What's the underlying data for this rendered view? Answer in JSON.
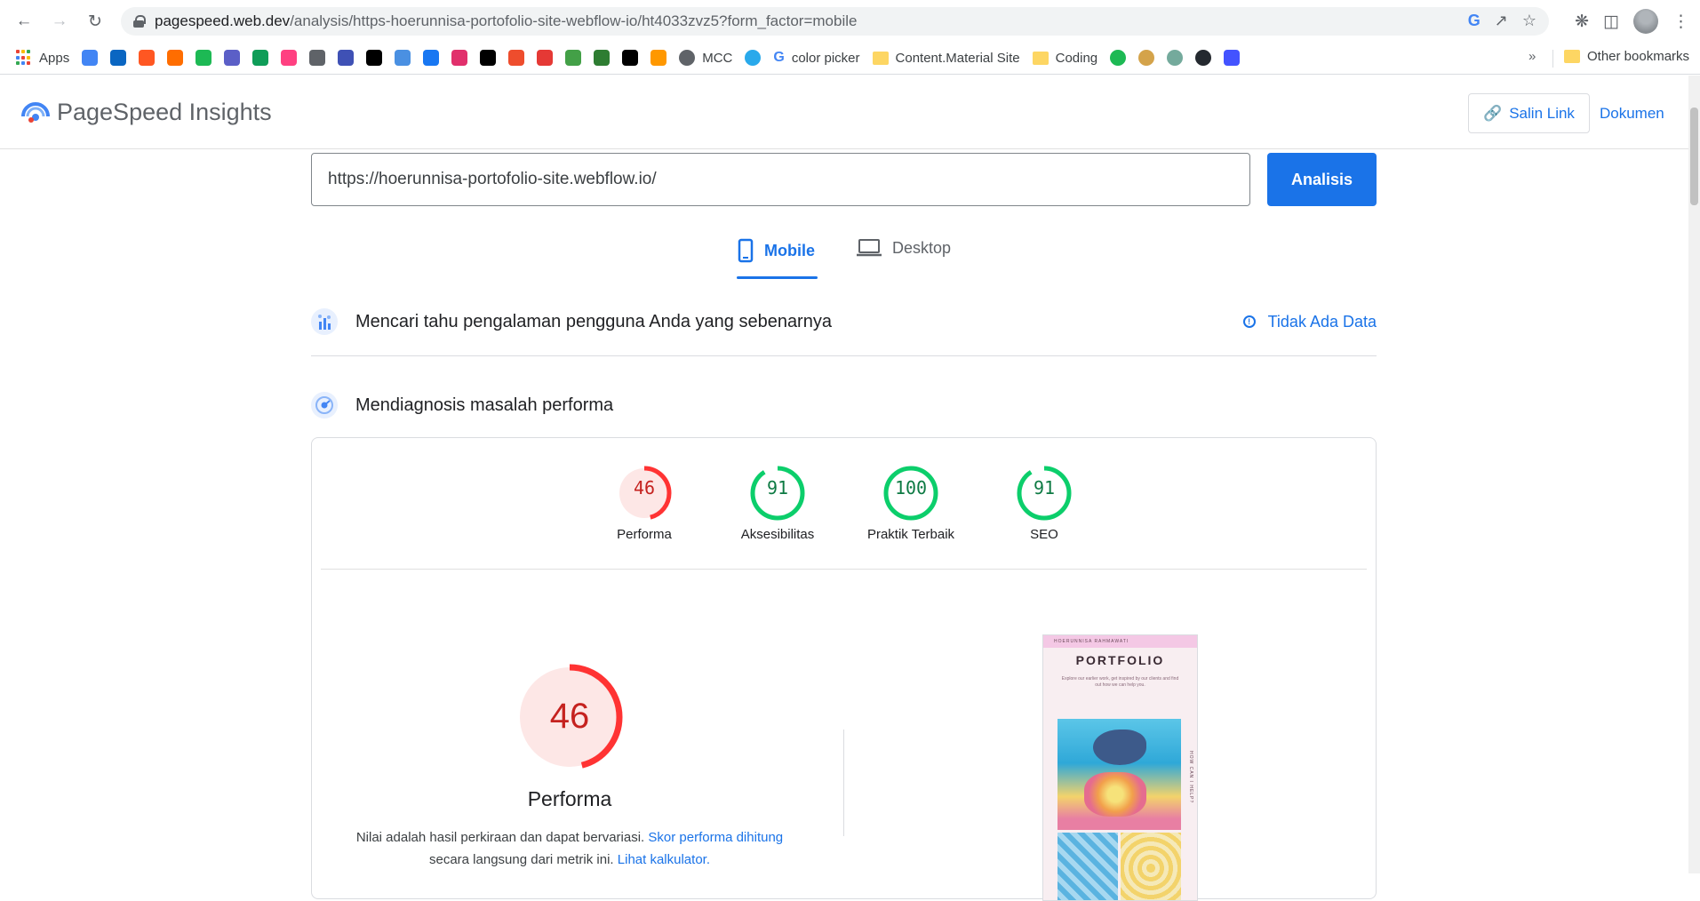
{
  "browser": {
    "url_host": "pagespeed.web.dev",
    "url_path": "/analysis/https-hoerunnisa-portofolio-site-webflow-io/ht4033zvz5?form_factor=mobile"
  },
  "bookmarks": {
    "apps_label": "Apps",
    "mcc_label": "MCC",
    "color_picker_label": "color picker",
    "content_material_label": "Content.Material Site",
    "coding_label": "Coding",
    "more_label": "»",
    "other_label": "Other bookmarks",
    "icon_colors": [
      "#4285f4",
      "#0a66c2",
      "#ff5722",
      "#ff6d00",
      "#1db954",
      "#5b5fc7",
      "#0f9d58",
      "#ff4081",
      "#5f6368",
      "#3f51b5",
      "#000000",
      "#4a90e2",
      "#1877f2",
      "#e1306c",
      "#000000",
      "#ee4d2d",
      "#e53935",
      "#43a047",
      "#2e7d32",
      "#000000",
      "#ff9800"
    ]
  },
  "header": {
    "title": "PageSpeed Insights",
    "copy_link_label": "Salin Link",
    "docs_label": "Dokumen"
  },
  "analysis": {
    "url_value": "https://hoerunnisa-portofolio-site.webflow.io/",
    "analyze_label": "Analisis"
  },
  "tabs": {
    "mobile_label": "Mobile",
    "desktop_label": "Desktop"
  },
  "field_data": {
    "title": "Mencari tahu pengalaman pengguna Anda yang sebenarnya",
    "no_data_label": "Tidak Ada Data"
  },
  "lab_data": {
    "title": "Mendiagnosis masalah performa"
  },
  "scores": [
    {
      "label": "Performa",
      "value": "46",
      "fraction": 0.46,
      "color": "#ff3333",
      "fill": "#fde7e6",
      "text_color": "#c5221f"
    },
    {
      "label": "Aksesibilitas",
      "value": "91",
      "fraction": 0.91,
      "color": "#0cce6b",
      "fill": "#ffffff",
      "text_color": "#0d7a43"
    },
    {
      "label": "Praktik Terbaik",
      "value": "100",
      "fraction": 1.0,
      "color": "#0cce6b",
      "fill": "#ffffff",
      "text_color": "#0d7a43"
    },
    {
      "label": "SEO",
      "value": "91",
      "fraction": 0.91,
      "color": "#0cce6b",
      "fill": "#ffffff",
      "text_color": "#0d7a43"
    }
  ],
  "performance_detail": {
    "score": "46",
    "fraction": 0.46,
    "label": "Performa",
    "note_prefix": "Nilai adalah hasil perkiraan dan dapat bervariasi.",
    "note_link1": "Skor performa dihitung",
    "note_middle": "secara langsung dari metrik ini.",
    "note_link2": "Lihat kalkulator."
  },
  "screenshot": {
    "top_text": "HOERUNNISA RAHMAWATI",
    "title": "PORTFOLIO",
    "subtitle": "Explore our earlier work, get inspired by our clients and find out how we can help you.",
    "side_text": "HOW CAN I HELP?"
  }
}
